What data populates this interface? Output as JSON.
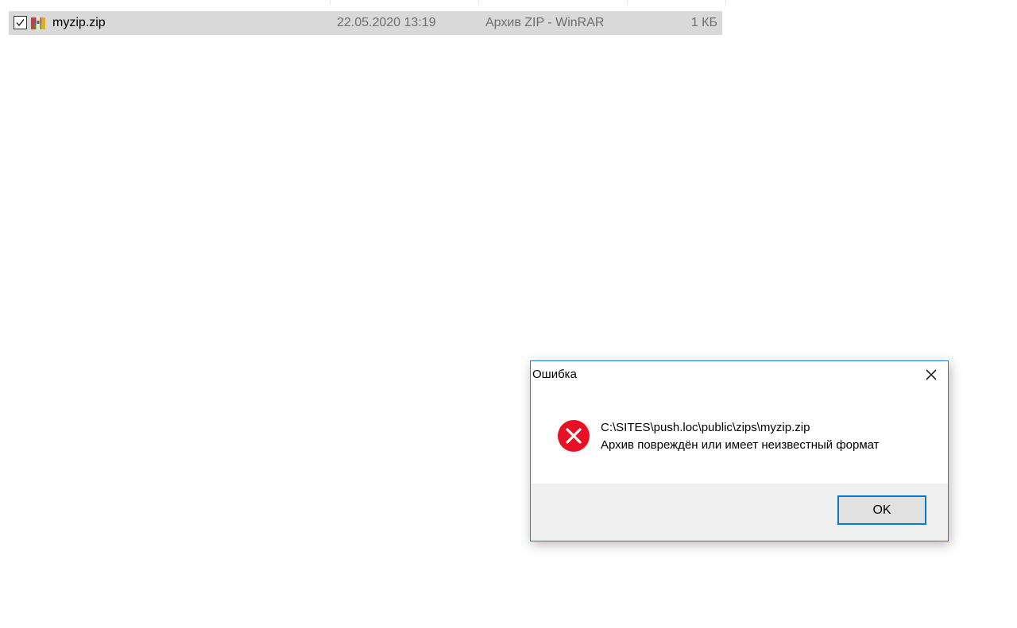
{
  "file_list": {
    "rows": [
      {
        "name": "myzip.zip",
        "date_modified": "22.05.2020 13:19",
        "type": "Архив ZIP - WinRAR",
        "size": "1 КБ",
        "checked": true
      }
    ]
  },
  "dialog": {
    "title": "Ошибка",
    "message_path": "C:\\SITES\\push.loc\\public\\zips\\myzip.zip",
    "message_text": "Архив повреждён или имеет неизвестный формат",
    "ok_label": "OK"
  },
  "colors": {
    "error_red": "#e81123",
    "accent_blue": "#0078d7",
    "selected_row": "#d9d9d9"
  },
  "icons": {
    "file": "winrar-archive-icon",
    "error": "error-circle-icon",
    "close": "close-icon",
    "checkbox": "checkbox-checked-icon"
  }
}
